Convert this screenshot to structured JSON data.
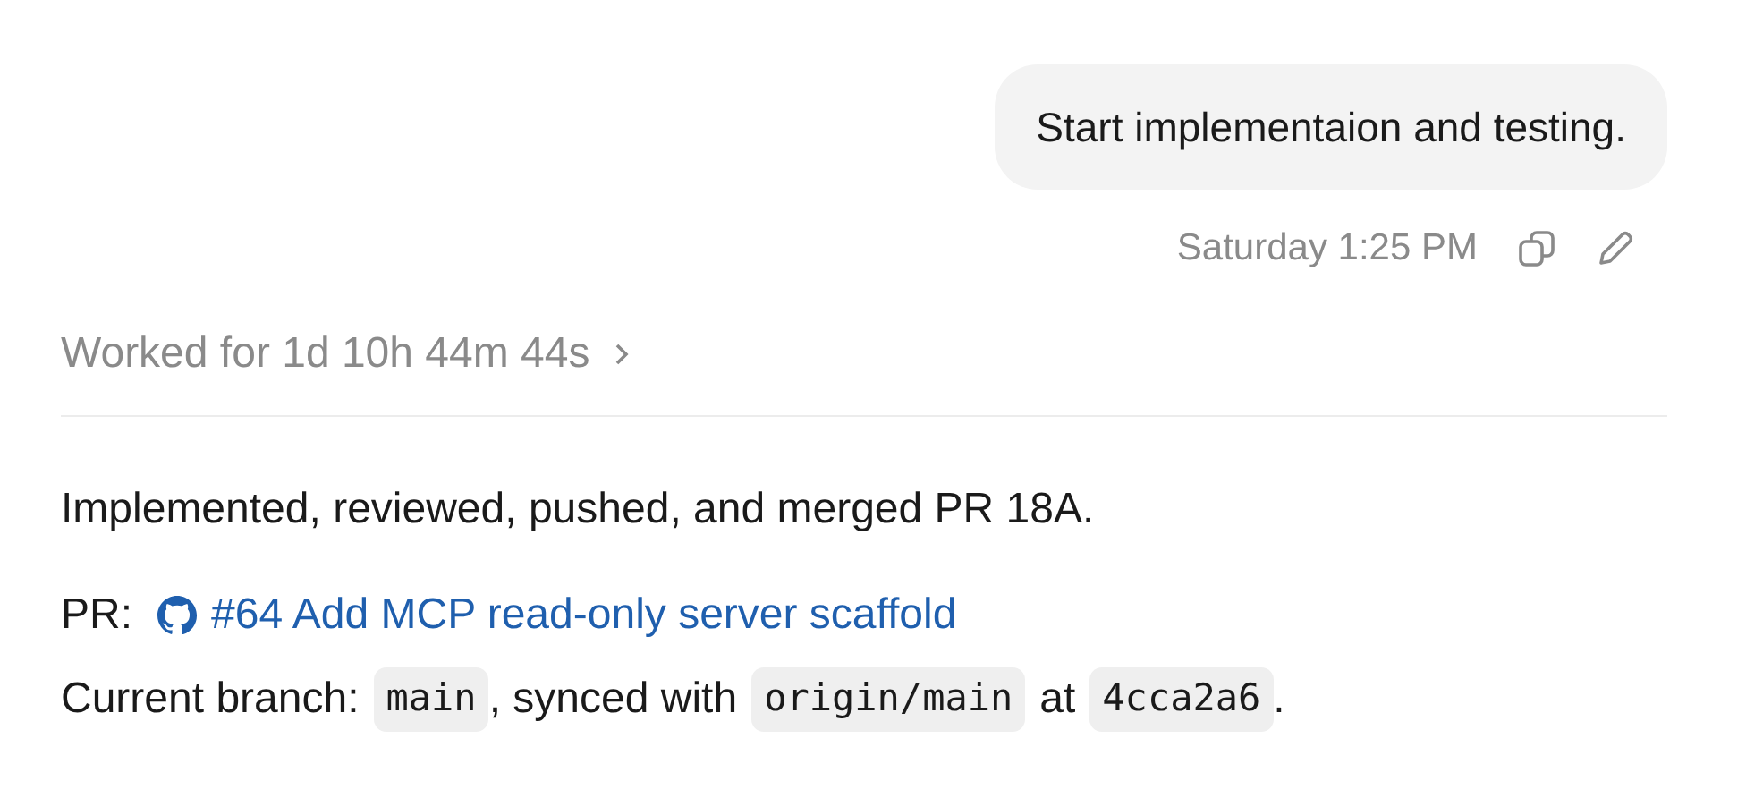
{
  "user_message": {
    "text": "Start implementaion and testing.",
    "timestamp": "Saturday 1:25 PM"
  },
  "worked_for": {
    "text": "Worked for 1d 10h 44m 44s",
    "expanded": false
  },
  "summary": "Implemented, reviewed, pushed, and merged PR 18A.",
  "pr": {
    "label": "PR:",
    "link": "#64 Add MCP read-only server scaffold"
  },
  "branch_line": [
    {
      "kind": "text",
      "text": "Current branch:"
    },
    {
      "kind": "code",
      "text": "main"
    },
    {
      "kind": "text",
      "text": ", synced with"
    },
    {
      "kind": "code",
      "text": "origin/main"
    },
    {
      "kind": "text",
      "text": "at"
    },
    {
      "kind": "code",
      "text": "4cca2a6"
    },
    {
      "kind": "text",
      "text": "."
    }
  ]
}
